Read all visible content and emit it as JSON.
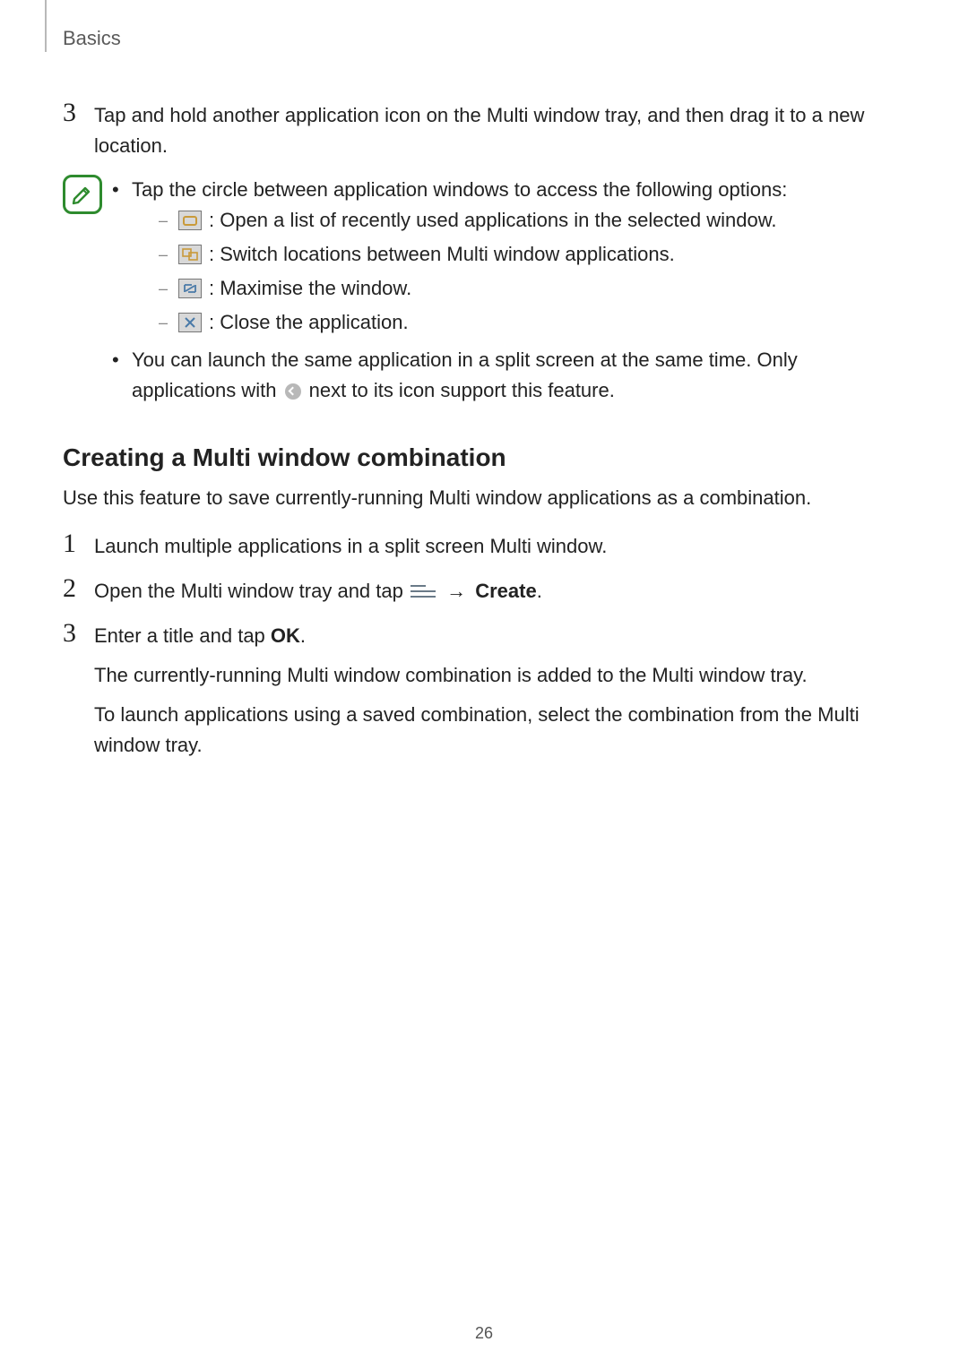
{
  "header": {
    "section": "Basics"
  },
  "step3_top": {
    "num": "3",
    "text": "Tap and hold another application icon on the Multi window tray, and then drag it to a new location."
  },
  "note": {
    "bullet1": "Tap the circle between application windows to access the following options:",
    "opt_recent": ": Open a list of recently used applications in the selected window.",
    "opt_switch": ": Switch locations between Multi window applications.",
    "opt_max": ": Maximise the window.",
    "opt_close": ": Close the application.",
    "bullet2_before": "You can launch the same application in a split screen at the same time. Only applications with ",
    "bullet2_after": " next to its icon support this feature."
  },
  "section2": {
    "heading": "Creating a Multi window combination",
    "intro": "Use this feature to save currently-running Multi window applications as a combination.",
    "step1": {
      "num": "1",
      "text": "Launch multiple applications in a split screen Multi window."
    },
    "step2": {
      "num": "2",
      "before": "Open the Multi window tray and tap ",
      "create": "Create",
      "after": "."
    },
    "step3": {
      "num": "3",
      "line1_before": "Enter a title and tap ",
      "ok": "OK",
      "line1_after": ".",
      "para2": "The currently-running Multi window combination is added to the Multi window tray.",
      "para3": "To launch applications using a saved combination, select the combination from the Multi window tray."
    }
  },
  "page_number": "26"
}
